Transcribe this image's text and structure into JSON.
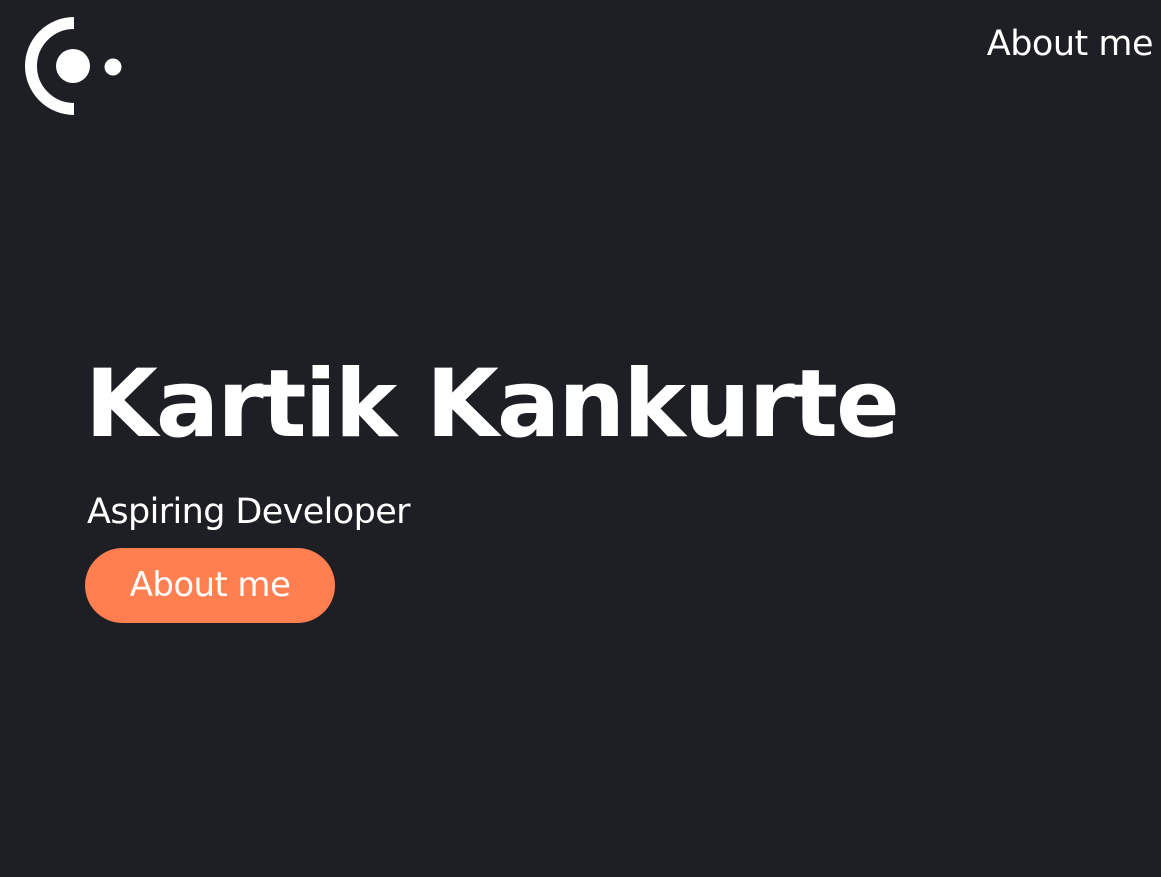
{
  "theme": {
    "background": "#1e1e25",
    "text": "#ffffff",
    "accent": "#ff7f50"
  },
  "header": {
    "logo_icon": "circle-dot-logo-icon",
    "nav_link_label": "About me"
  },
  "hero": {
    "title": "Kartik Kankurte",
    "subtitle": "Aspiring Developer",
    "cta_label": "About me"
  }
}
